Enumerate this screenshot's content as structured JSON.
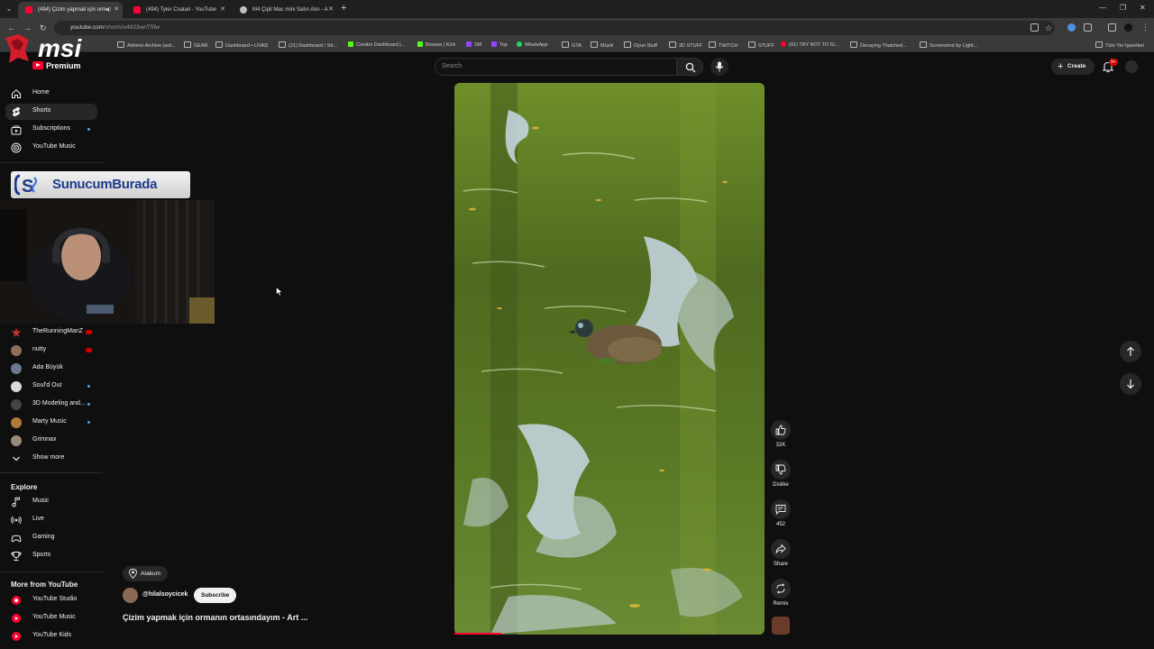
{
  "browser": {
    "tabs": [
      {
        "title": "(494) Çizim yapmak için orm",
        "active": true
      },
      {
        "title": "(494) Tyler Csatari - YouTube",
        "active": false
      },
      {
        "title": "M4 Çipli Mac mini Satın Alın - A",
        "active": false
      }
    ],
    "url": "youtube.com",
    "url_path": "/shorts/o4833wnT5fw",
    "bookmarks": [
      "Admins Archive (ard...",
      "GEAR",
      "Dashboard • LIVAD",
      "(21) Dashboard / Str...",
      "Creator Dashboard |...",
      "Browse | Kick",
      "SM",
      "Top",
      "WhatsApp",
      "GTA",
      "Müzik",
      "Oyun Stuff",
      "3D STUFF",
      "TWITCH",
      "STUFF",
      "(91) TRY NOT TO SI...",
      "Decaying Thatched...",
      "Screenshot by Light...",
      "Tüm Yer İşaretleri"
    ]
  },
  "overlay": {
    "brand": "msi",
    "banner_part1": "Sunucum",
    "banner_part2": "Burada"
  },
  "header": {
    "logo_label": "Premium",
    "search_placeholder": "Search",
    "create_label": "Create",
    "notif_count": "9+"
  },
  "sidebar": {
    "main": [
      {
        "label": "Home",
        "icon": "home-icon"
      },
      {
        "label": "Shorts",
        "icon": "shorts-icon",
        "selected": true
      },
      {
        "label": "Subscriptions",
        "icon": "subscriptions-icon"
      },
      {
        "label": "YouTube Music",
        "icon": "youtube-music-icon"
      }
    ],
    "subscriptions": [
      {
        "label": "TheRunningManZ",
        "color": "#c0392b",
        "live": true
      },
      {
        "label": "nutty",
        "color": "#8e6d5a",
        "live": true
      },
      {
        "label": "Ada Büyük",
        "color": "#6b7a8f"
      },
      {
        "label": "Soul'd Out",
        "color": "#d9d9d9",
        "dot": true
      },
      {
        "label": "3D Modeling and...",
        "color": "#444444",
        "dot": true
      },
      {
        "label": "Marty Music",
        "color": "#b07a3a",
        "dot": true
      },
      {
        "label": "Grimnax",
        "color": "#9a8a7a"
      }
    ],
    "show_more": "Show more",
    "explore_title": "Explore",
    "explore": [
      {
        "label": "Music",
        "icon": "music-icon"
      },
      {
        "label": "Live",
        "icon": "live-icon"
      },
      {
        "label": "Gaming",
        "icon": "gaming-icon"
      },
      {
        "label": "Sports",
        "icon": "sports-icon"
      }
    ],
    "more_title": "More from YouTube",
    "more": [
      {
        "label": "YouTube Studio"
      },
      {
        "label": "YouTube Music"
      },
      {
        "label": "YouTube Kids"
      }
    ]
  },
  "short": {
    "location": "Atakum",
    "channel": "@hilalsoycicek",
    "subscribe_label": "Subscribe",
    "title": "Çizim yapmak için ormanın ortasındayım - Art ...",
    "progress": 0.15,
    "actions": {
      "like_count": "32K",
      "dislike_label": "Dislike",
      "comment_count": "452",
      "share_label": "Share",
      "remix_label": "Remix"
    }
  }
}
